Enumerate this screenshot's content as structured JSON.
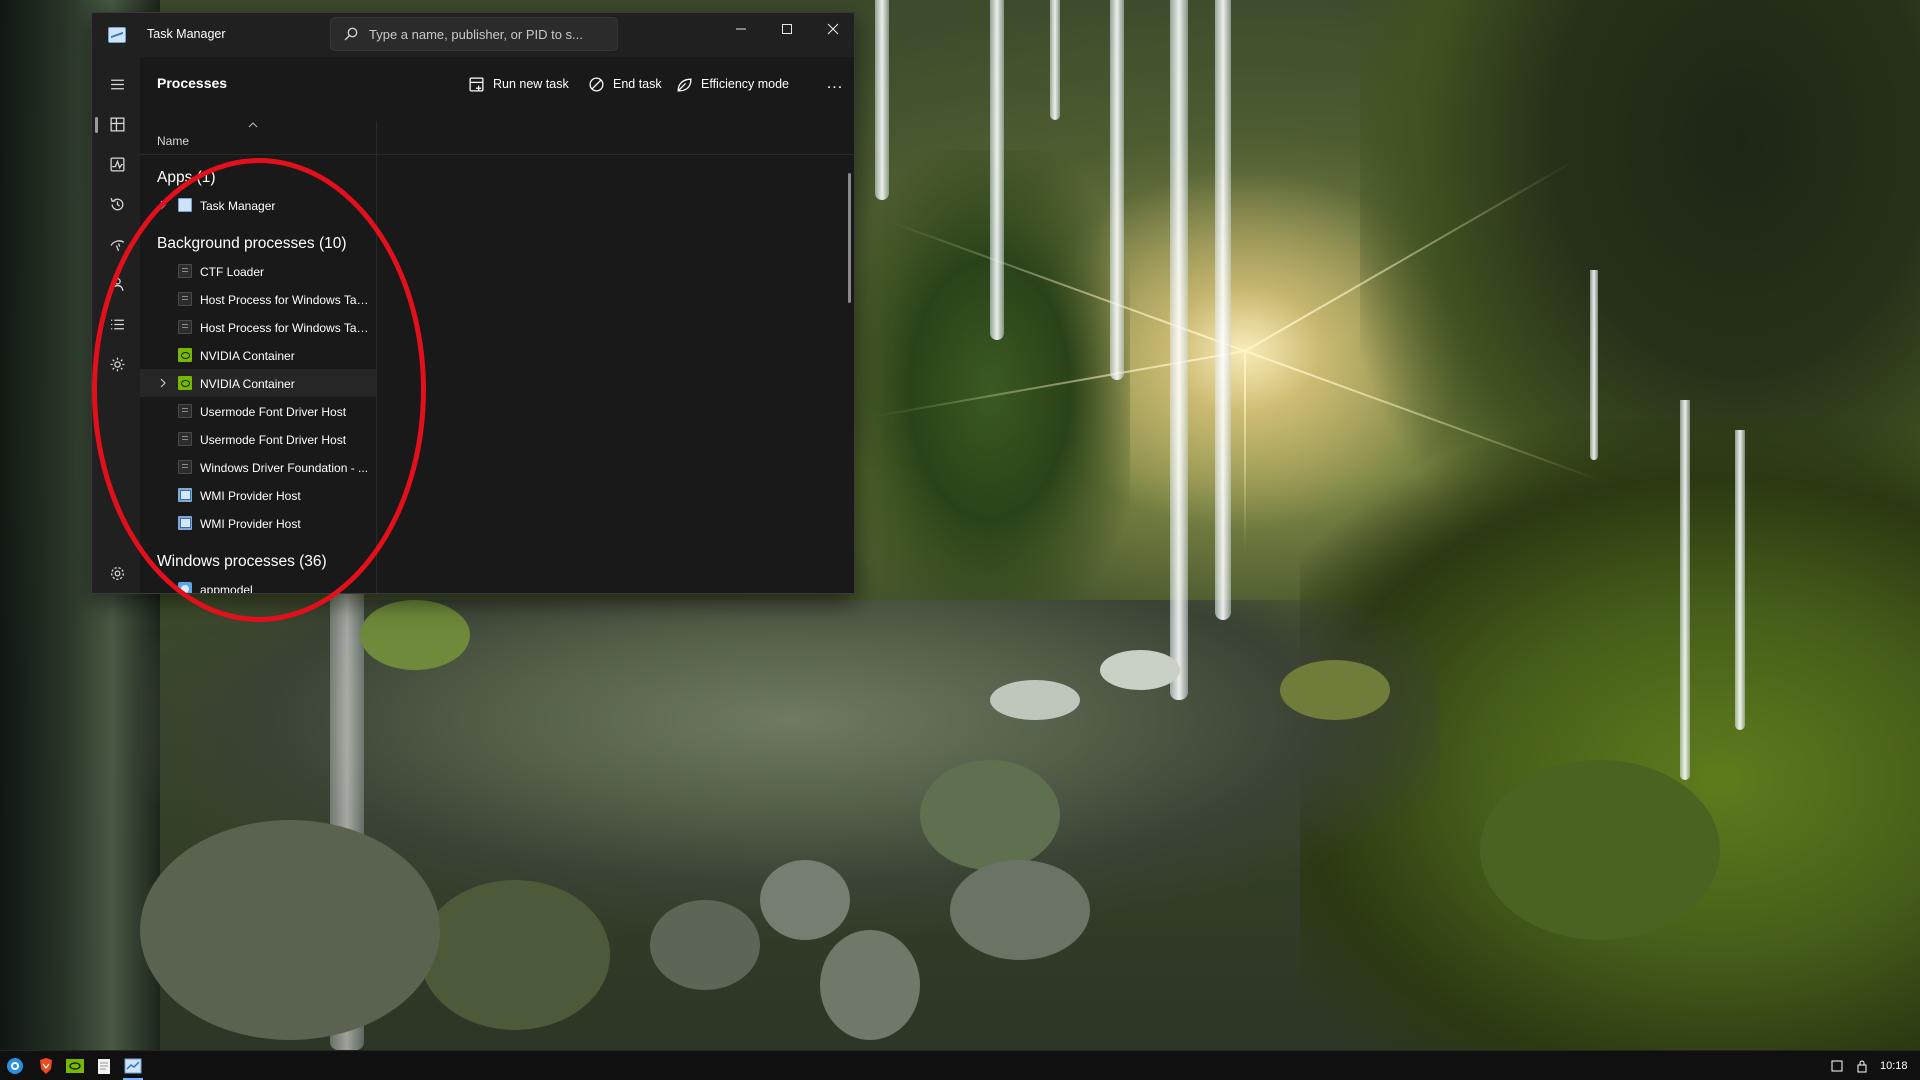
{
  "window": {
    "title": "Task Manager",
    "search_placeholder": "Type a name, publisher, or PID to s..."
  },
  "commandbar": {
    "page_title": "Processes",
    "run_new_task": "Run new task",
    "end_task": "End task",
    "efficiency_mode": "Efficiency mode",
    "more": "..."
  },
  "table": {
    "name_header": "Name"
  },
  "groups": {
    "apps": {
      "header": "Apps (1)",
      "items": [
        {
          "label": "Task Manager",
          "icon": "task-manager-icon",
          "expandable": true
        }
      ]
    },
    "background": {
      "header": "Background processes (10)",
      "items": [
        {
          "label": "CTF Loader",
          "icon": "generic-process-icon",
          "expandable": false
        },
        {
          "label": "Host Process for Windows Tasks",
          "icon": "generic-process-icon",
          "expandable": false
        },
        {
          "label": "Host Process for Windows Tasks",
          "icon": "generic-process-icon",
          "expandable": false
        },
        {
          "label": "NVIDIA Container",
          "icon": "nvidia-icon",
          "expandable": false
        },
        {
          "label": "NVIDIA Container",
          "icon": "nvidia-icon",
          "expandable": true
        },
        {
          "label": "Usermode Font Driver Host",
          "icon": "generic-process-icon",
          "expandable": false
        },
        {
          "label": "Usermode Font Driver Host",
          "icon": "generic-process-icon",
          "expandable": false
        },
        {
          "label": "Windows Driver Foundation - ...",
          "icon": "generic-process-icon",
          "expandable": false
        },
        {
          "label": "WMI Provider Host",
          "icon": "wmi-icon",
          "expandable": false
        },
        {
          "label": "WMI Provider Host",
          "icon": "wmi-icon",
          "expandable": false
        }
      ]
    },
    "windows": {
      "header": "Windows processes (36)",
      "items": [
        {
          "label": "appmodel",
          "icon": "appmodel-icon",
          "expandable": false
        }
      ]
    }
  },
  "taskbar": {
    "clock": "10:18"
  },
  "colors": {
    "annotation": "#e3101c",
    "window_bg": "#1c1c1c",
    "nvidia_green": "#76b900"
  }
}
